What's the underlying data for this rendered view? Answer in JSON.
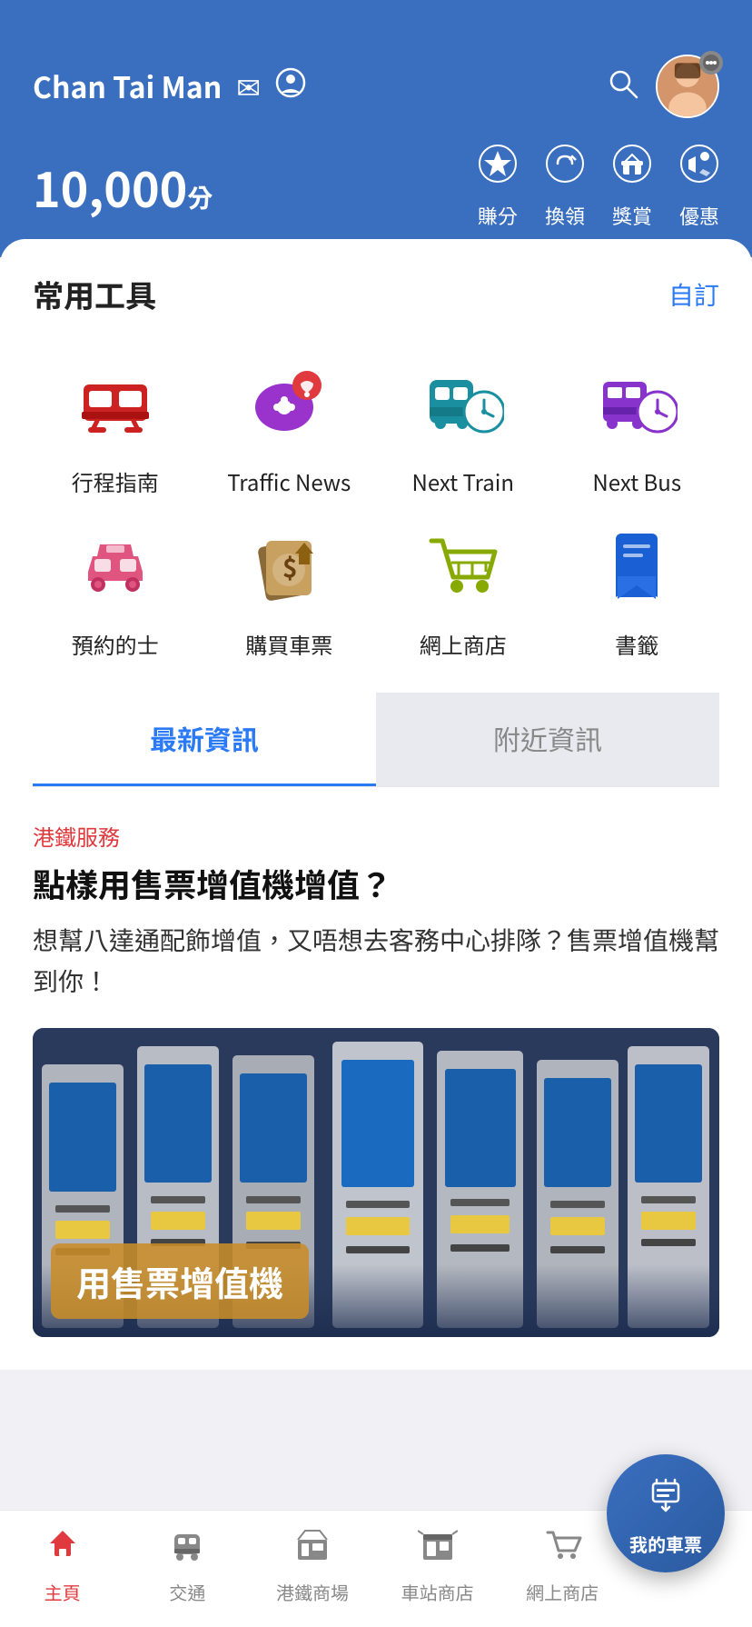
{
  "header": {
    "user_name": "Chan Tai Man",
    "mail_icon": "✉",
    "profile_icon": "👤",
    "search_icon": "🔍",
    "points": "10,000",
    "points_unit": "分",
    "quick_actions": [
      {
        "id": "earn",
        "label": "賺分",
        "icon": "⭐"
      },
      {
        "id": "redeem",
        "label": "換領",
        "icon": "🔄"
      },
      {
        "id": "rewards",
        "label": "獎賞",
        "icon": "🎁"
      },
      {
        "id": "offers",
        "label": "優惠",
        "icon": "📢"
      }
    ]
  },
  "tools": {
    "section_title": "常用工具",
    "section_action": "自訂",
    "items": [
      {
        "id": "journey",
        "label": "行程指南",
        "icon": "train"
      },
      {
        "id": "traffic_news",
        "label": "Traffic News",
        "icon": "chat"
      },
      {
        "id": "next_train",
        "label": "Next Train",
        "icon": "next_train"
      },
      {
        "id": "next_bus",
        "label": "Next Bus",
        "icon": "next_bus"
      },
      {
        "id": "taxi",
        "label": "預約的士",
        "icon": "taxi"
      },
      {
        "id": "buy_ticket",
        "label": "購買車票",
        "icon": "ticket"
      },
      {
        "id": "online_shop",
        "label": "網上商店",
        "icon": "cart"
      },
      {
        "id": "bookmark",
        "label": "書籤",
        "icon": "bookmark"
      }
    ]
  },
  "tabs": [
    {
      "id": "latest",
      "label": "最新資訊",
      "active": true
    },
    {
      "id": "nearby",
      "label": "附近資訊",
      "active": false
    }
  ],
  "news": {
    "category": "港鐵服務",
    "title": "點樣用售票增值機增值？",
    "description": "想幫八達通配飾增值，又唔想去客務中心排隊？售票增值機幫到你！",
    "image_label": "用售票增值機"
  },
  "float_btn": {
    "label": "我的車票",
    "icon": "🎫"
  },
  "bottom_nav": [
    {
      "id": "home",
      "label": "主頁",
      "active": true,
      "icon": "✳"
    },
    {
      "id": "transport",
      "label": "交通",
      "active": false,
      "icon": "🚇"
    },
    {
      "id": "mall",
      "label": "港鐵商場",
      "active": false,
      "icon": "🏢"
    },
    {
      "id": "station_shop",
      "label": "車站商店",
      "active": false,
      "icon": "🏪"
    },
    {
      "id": "online_shop",
      "label": "網上商店",
      "active": false,
      "icon": "🛒"
    }
  ],
  "colors": {
    "header_bg": "#3a6fbf",
    "accent_blue": "#2a7af5",
    "red": "#e0393e",
    "train_red": "#cc2222",
    "teal": "#1a8fa0",
    "purple": "#8833aa",
    "olive": "#88aa00",
    "dark_blue": "#1a3a7f"
  }
}
